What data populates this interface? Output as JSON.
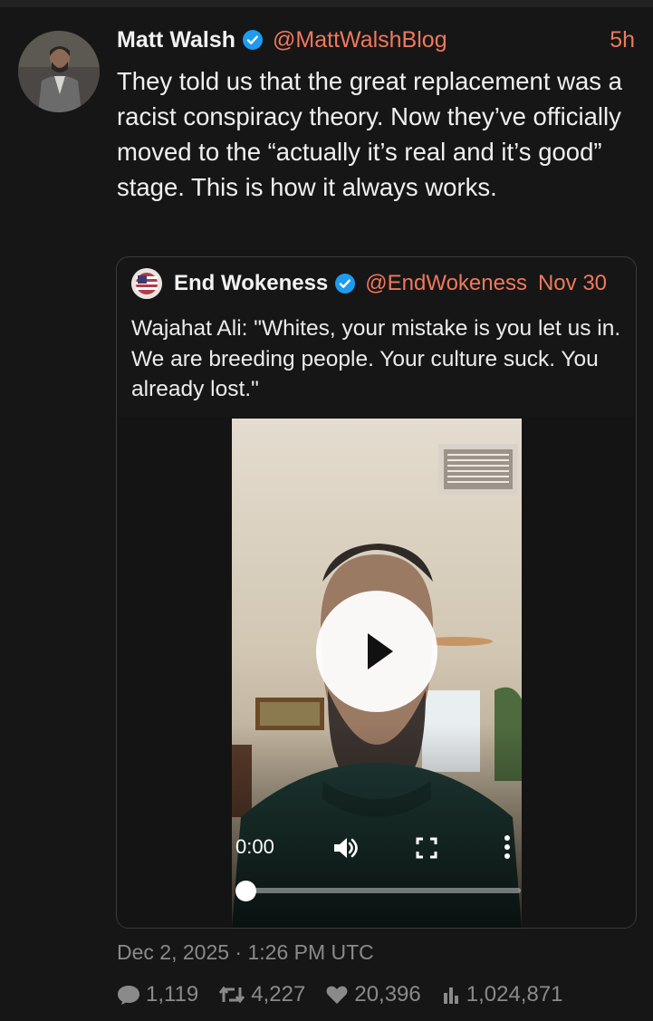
{
  "tweet": {
    "author_name": "Matt Walsh",
    "handle": "@MattWalshBlog",
    "time": "5h",
    "text": "They told us that the great replacement was a racist conspiracy theory. Now they’ve officially moved to the “actually it’s real and it’s good” stage. This is how it always works.",
    "timestamp": "Dec 2, 2025 · 1:26 PM UTC"
  },
  "quote": {
    "author_name": "End Wokeness",
    "handle": "@EndWokeness",
    "date": "Nov 30",
    "text": "Wajahat Ali: \"Whites, your mistake is you let us in. We are breeding people. Your culture suck. You already lost.\"",
    "video": {
      "time": "0:00",
      "progress": 0
    }
  },
  "stats": {
    "replies": "1,119",
    "retweets": "4,227",
    "likes": "20,396",
    "views": "1,024,871"
  },
  "colors": {
    "background": "#161616",
    "accent": "#f0785c",
    "verified": "#1d9bf0",
    "muted": "#8a8a8a"
  },
  "icons": [
    "verified-badge-icon",
    "play-icon",
    "volume-icon",
    "fullscreen-icon",
    "more-vertical-icon",
    "reply-icon",
    "retweet-icon",
    "like-icon",
    "views-icon"
  ]
}
